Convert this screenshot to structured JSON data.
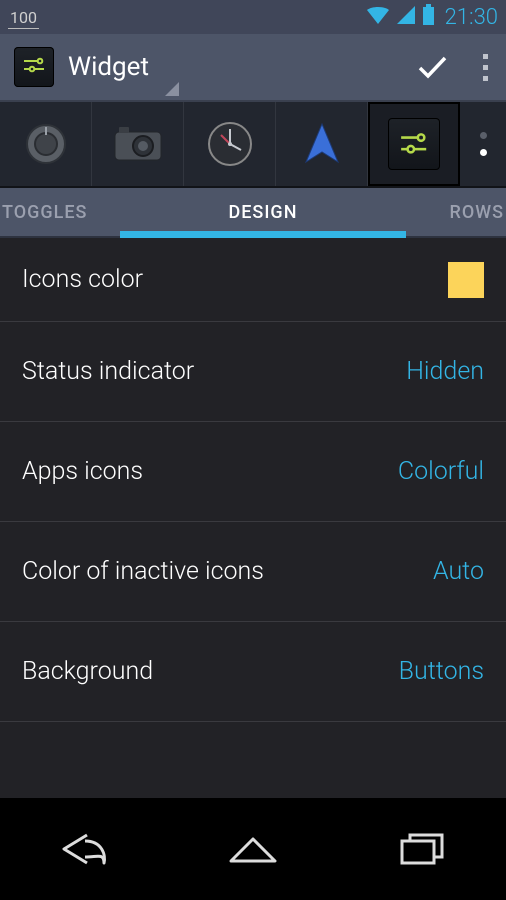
{
  "statusbar": {
    "battery_text": "100",
    "clock": "21:30"
  },
  "actionbar": {
    "title": "Widget"
  },
  "tabs": {
    "left": "TOGGLES",
    "center": "DESIGN",
    "right": "ROWS"
  },
  "settings": [
    {
      "label": "Icons color",
      "value_type": "swatch",
      "value": "#fcd45a"
    },
    {
      "label": "Status indicator",
      "value_type": "text",
      "value": "Hidden"
    },
    {
      "label": "Apps icons",
      "value_type": "text",
      "value": "Colorful"
    },
    {
      "label": "Color of inactive icons",
      "value_type": "text",
      "value": "Auto"
    },
    {
      "label": "Background",
      "value_type": "text",
      "value": "Buttons"
    }
  ],
  "iconstrip": {
    "items": [
      "dial-icon",
      "camera-icon",
      "clock-icon",
      "navigate-icon",
      "app-icon"
    ],
    "selected_index": 4
  },
  "colors": {
    "accent": "#33b5e5",
    "icons_swatch": "#fcd45a"
  }
}
